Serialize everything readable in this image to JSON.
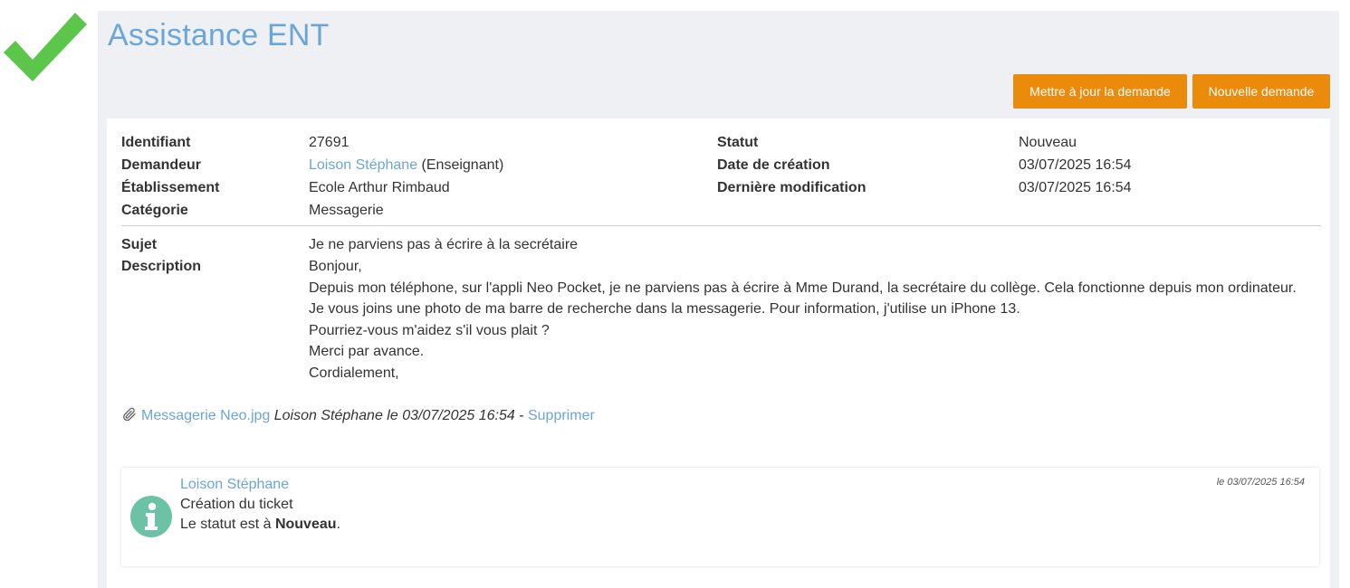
{
  "header": {
    "title": "Assistance ENT",
    "buttons": {
      "update": "Mettre à jour la demande",
      "new": "Nouvelle demande"
    }
  },
  "ticket": {
    "fields": {
      "id_label": "Identifiant",
      "id_value": "27691",
      "requester_label": "Demandeur",
      "requester_name": "Loison Stéphane",
      "requester_role": " (Enseignant)",
      "school_label": "Établissement",
      "school_value": "Ecole Arthur Rimbaud",
      "category_label": "Catégorie",
      "category_value": "Messagerie",
      "status_label": "Statut",
      "status_value": "Nouveau",
      "created_label": "Date de création",
      "created_value": "03/07/2025 16:54",
      "modified_label": "Dernière modification",
      "modified_value": "03/07/2025 16:54"
    },
    "subject_label": "Sujet",
    "subject_value": "Je ne parviens pas à écrire à la secrétaire",
    "description_label": "Description",
    "description_lines": [
      "Bonjour,",
      "Depuis mon téléphone, sur l'appli Neo Pocket, je ne parviens pas à écrire à Mme Durand, la secrétaire du collège. Cela fonctionne depuis mon ordinateur.",
      "Je vous joins une photo de ma barre de recherche dans la messagerie. Pour information, j'utilise un iPhone 13.",
      "Pourriez-vous m'aidez s'il vous plait ?",
      "Merci par avance.",
      "Cordialement,"
    ],
    "attachment": {
      "icon": "paperclip-icon",
      "filename": "Messagerie Neo.jpg",
      "meta": "Loison Stéphane le 03/07/2025 16:54",
      "separator": " - ",
      "delete_label": "Supprimer"
    }
  },
  "history": [
    {
      "icon": "info-icon",
      "author": "Loison Stéphane",
      "action": "Création du ticket",
      "status_prefix": "Le statut est à ",
      "status_value": "Nouveau",
      "status_suffix": ".",
      "date": "le 03/07/2025 16:54"
    }
  ],
  "colors": {
    "accent": "#6ba6d6",
    "button": "#ea8b0b",
    "check": "#5cc64a",
    "info_icon": "#6bc2a5",
    "panel_bg": "#eef0f4"
  }
}
